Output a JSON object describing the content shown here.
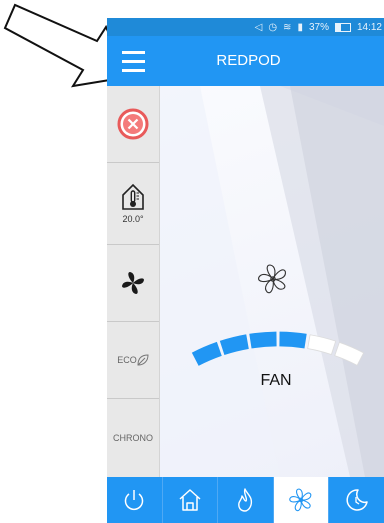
{
  "status_bar": {
    "icons": [
      "volume-icon",
      "alarm-icon",
      "wifi-icon",
      "signal-icon"
    ],
    "battery_text": "37%",
    "battery_level": 0.37,
    "time": "14:12"
  },
  "app_bar": {
    "title": "REDPOD",
    "menu_icon": "hamburger-menu-icon",
    "color": "#2196f3"
  },
  "sidebar": {
    "items": [
      {
        "icon": "power-off-x-icon",
        "label": ""
      },
      {
        "icon": "room-thermometer-icon",
        "label": "20.0°"
      },
      {
        "icon": "fan-icon",
        "label": ""
      },
      {
        "icon": "leaf-icon",
        "label": "ECO"
      },
      {
        "icon": "",
        "label": "CHRONO"
      }
    ]
  },
  "main": {
    "mode_label": "FAN",
    "mode_icon": "fan-outline-icon",
    "fan_level": {
      "selected": 4,
      "total": 6
    },
    "accent": "#2196f3"
  },
  "bottom_nav": {
    "tabs": [
      {
        "icon": "power-icon",
        "active": false
      },
      {
        "icon": "home-icon",
        "active": false
      },
      {
        "icon": "flame-icon",
        "active": false
      },
      {
        "icon": "fan-icon",
        "active": true
      },
      {
        "icon": "moon-clock-icon",
        "active": false
      }
    ]
  }
}
